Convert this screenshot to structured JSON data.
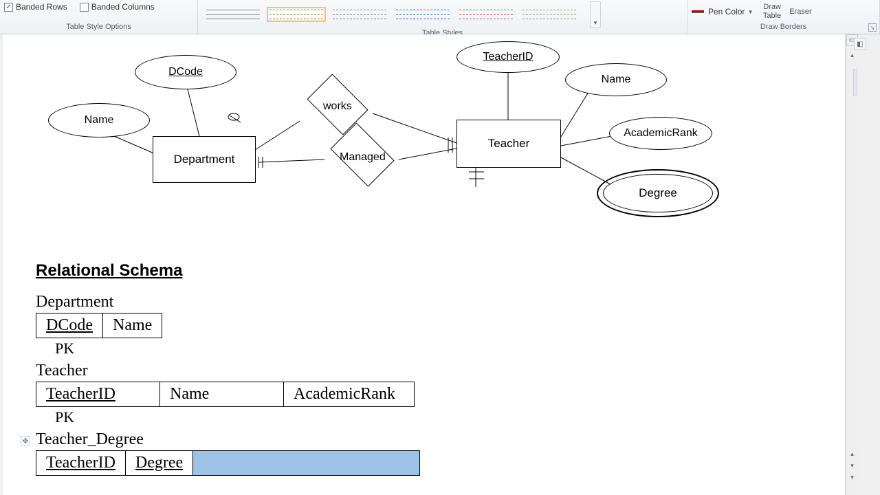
{
  "ribbon": {
    "options": {
      "banded_rows": "Banded Rows",
      "banded_cols": "Banded Columns",
      "group_label": "Table Style Options"
    },
    "styles": {
      "group_label": "Table Styles"
    },
    "borders": {
      "pen_color": "Pen Color",
      "draw1": "Draw",
      "draw2": "Table",
      "eraser": "Eraser",
      "group_label": "Draw Borders"
    }
  },
  "er": {
    "dcode": "DCode",
    "name_left": "Name",
    "department": "Department",
    "works": "works",
    "managed": "Managed",
    "teacher": "Teacher",
    "teacher_id": "TeacherID",
    "name_right": "Name",
    "academic_rank": "AcademicRank",
    "degree": "Degree"
  },
  "schema": {
    "heading": "Relational Schema",
    "dept": {
      "title": "Department",
      "c1": "DCode",
      "c2": "Name",
      "pk": "PK"
    },
    "teacher": {
      "title": "Teacher",
      "c1": "TeacherID",
      "c2": "Name",
      "c3": "AcademicRank",
      "pk": "PK"
    },
    "tdeg": {
      "title": "Teacher_Degree",
      "c1": "TeacherID",
      "c2": "Degree"
    }
  }
}
